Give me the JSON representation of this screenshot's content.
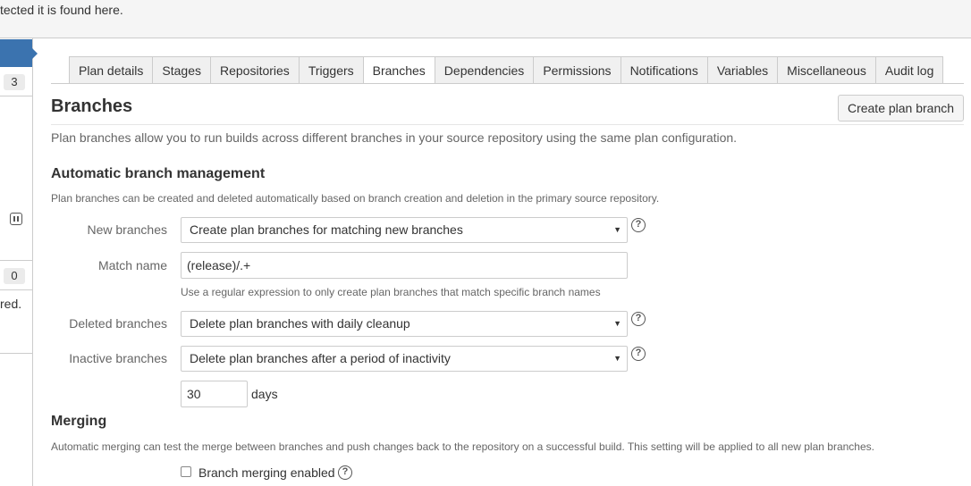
{
  "topbar": {
    "fragment_text": "tected it is found here."
  },
  "left_panel": {
    "badge_top": "3",
    "badge_bottom": "0",
    "fragment_text": "red.",
    "pause_icon": "pause-icon"
  },
  "tabs": [
    {
      "label": "Plan details",
      "active": false
    },
    {
      "label": "Stages",
      "active": false
    },
    {
      "label": "Repositories",
      "active": false
    },
    {
      "label": "Triggers",
      "active": false
    },
    {
      "label": "Branches",
      "active": true
    },
    {
      "label": "Dependencies",
      "active": false
    },
    {
      "label": "Permissions",
      "active": false
    },
    {
      "label": "Notifications",
      "active": false
    },
    {
      "label": "Variables",
      "active": false
    },
    {
      "label": "Miscellaneous",
      "active": false
    },
    {
      "label": "Audit log",
      "active": false
    }
  ],
  "page": {
    "title": "Branches",
    "create_button_label": "Create plan branch",
    "intro": "Plan branches allow you to run builds across different branches in your source repository using the same plan configuration."
  },
  "automatic": {
    "heading": "Automatic branch management",
    "description": "Plan branches can be created and deleted automatically based on branch creation and deletion in the primary source repository.",
    "new_branches": {
      "label": "New branches",
      "value": "Create plan branches for matching new branches"
    },
    "match_name": {
      "label": "Match name",
      "value": "(release)/.+",
      "hint": "Use a regular expression to only create plan branches that match specific branch names"
    },
    "deleted_branches": {
      "label": "Deleted branches",
      "value": "Delete plan branches with daily cleanup"
    },
    "inactive_branches": {
      "label": "Inactive branches",
      "value": "Delete plan branches after a period of inactivity"
    },
    "inactivity_days": {
      "value": "30",
      "unit": "days"
    }
  },
  "merging": {
    "heading": "Merging",
    "description": "Automatic merging can test the merge between branches and push changes back to the repository on a successful build. This setting will be applied to all new plan branches.",
    "checkbox_label": "Branch merging enabled",
    "checked": false
  },
  "icons": {
    "help": "?",
    "caret": "▼"
  },
  "colors": {
    "accent": "#3b73af",
    "border": "#cccccc",
    "tab_bg": "#f0f0f0"
  }
}
